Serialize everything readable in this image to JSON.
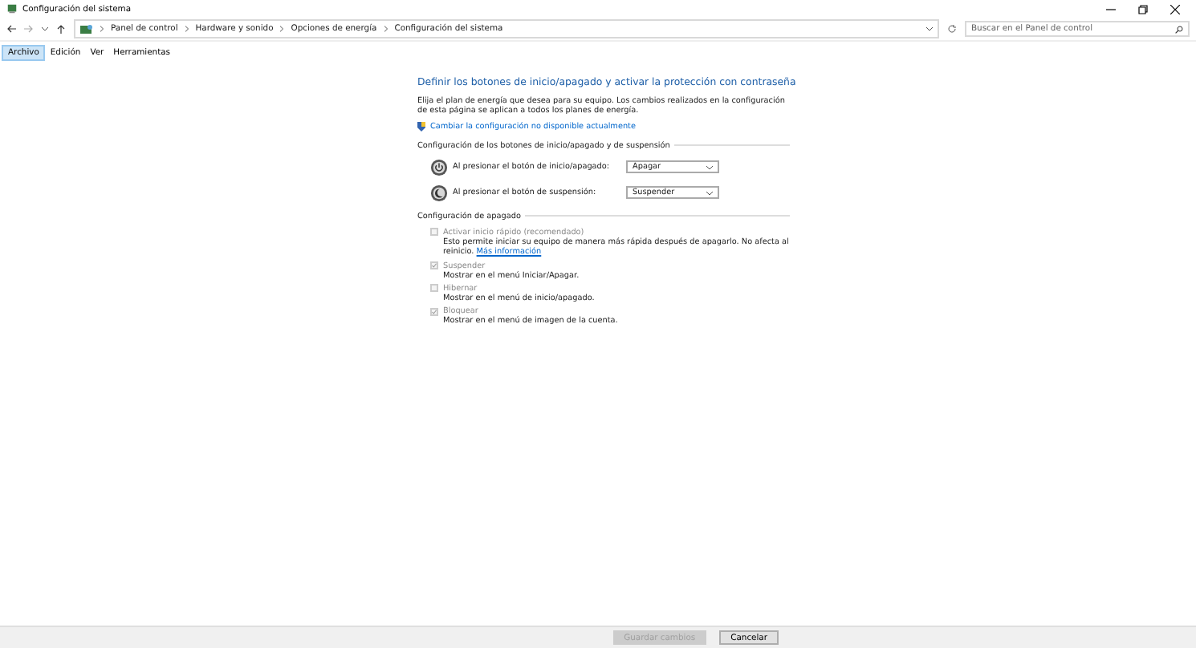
{
  "window": {
    "title": "Configuración del sistema"
  },
  "address": {
    "breadcrumbs": [
      "Panel de control",
      "Hardware y sonido",
      "Opciones de energía",
      "Configuración del sistema"
    ]
  },
  "search": {
    "placeholder": "Buscar en el Panel de control"
  },
  "menu": [
    {
      "label": "Archivo",
      "selected": true
    },
    {
      "label": "Edición",
      "selected": false
    },
    {
      "label": "Ver",
      "selected": false
    },
    {
      "label": "Herramientas",
      "selected": false
    }
  ],
  "page": {
    "heading": "Definir los botones de inicio/apagado y activar la protección con contraseña",
    "description": "Elija el plan de energía que desea para su equipo. Los cambios realizados en la configuración de esta página se aplican a todos los planes de energía.",
    "admin_link": "Cambiar la configuración no disponible actualmente",
    "buttons_section": "Configuración de los botones de inicio/apagado y de suspensión",
    "settings": [
      {
        "kind": "power",
        "label": "Al presionar el botón de inicio/apagado:",
        "value": "Apagar"
      },
      {
        "kind": "sleep",
        "label": "Al presionar el botón de suspensión:",
        "value": "Suspender"
      }
    ],
    "shutdown_section": "Configuración de apagado",
    "options": [
      {
        "label": "Activar inicio rápido (recomendado)",
        "checked": false,
        "disabled": true,
        "description": "Esto permite iniciar su equipo de manera más rápida después de apagarlo. No afecta al reinicio.",
        "link": "Más información"
      },
      {
        "label": "Suspender",
        "checked": true,
        "disabled": true,
        "description": "Mostrar en el menú Iniciar/Apagar."
      },
      {
        "label": "Hibernar",
        "checked": false,
        "disabled": true,
        "description": "Mostrar en el menú de inicio/apagado."
      },
      {
        "label": "Bloquear",
        "checked": true,
        "disabled": true,
        "description": "Mostrar en el menú de imagen de la cuenta."
      }
    ]
  },
  "buttons": [
    {
      "label": "Guardar cambios",
      "disabled": true
    },
    {
      "label": "Cancelar",
      "disabled": false
    }
  ]
}
